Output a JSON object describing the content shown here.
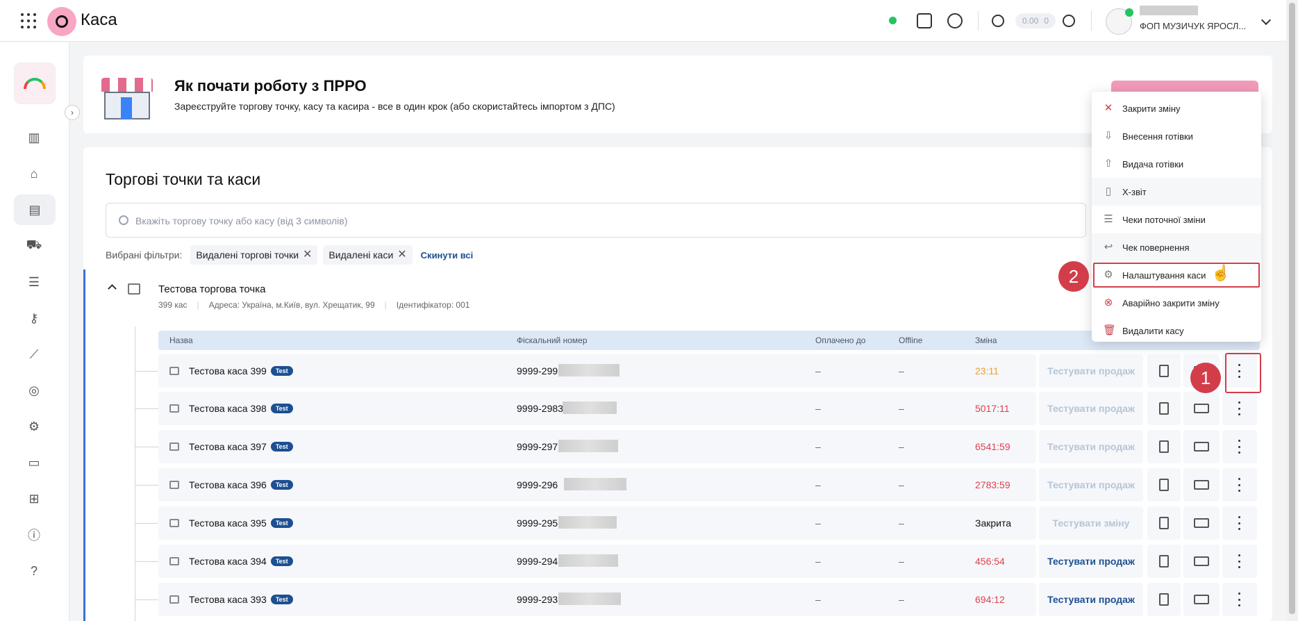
{
  "header": {
    "brand": "Каса",
    "balance_amount": "0.00",
    "balance_count": "0",
    "account_name": "ФОП МУЗИЧУК ЯРОСЛ..."
  },
  "banner": {
    "title": "Як почати роботу з ПРРО",
    "subtitle": "Зареєструйте торгову точку, касу та касира - все в один крок (або скористайтесь імпортом з ДПС)"
  },
  "section": {
    "title": "Торгові точки та каси",
    "search_placeholder": "Вкажіть торгову точку або касу (від 3 символів)",
    "filters_label": "Вибрані фільтри:",
    "filters": [
      "Видалені торгові точки",
      "Видалені каси"
    ],
    "reset_label": "Скинути всі"
  },
  "point": {
    "name": "Тестова торгова точка",
    "count": "399 кас",
    "address": "Адреса: Україна, м.Київ, вул. Хрещатик, 99",
    "identifier": "Ідентифікатор: 001"
  },
  "table": {
    "headers": [
      "Назва",
      "Фіскальний номер",
      "Оплачено до",
      "Offline",
      "Зміна"
    ],
    "badge": "Test",
    "rows": [
      {
        "name": "Тестова каса 399",
        "fiscal": "9999-299",
        "paid": "–",
        "offline": "–",
        "shift": "23:11",
        "shift_color": "#f0a030",
        "action": "Тестувати продаж",
        "action_enabled": false
      },
      {
        "name": "Тестова каса 398",
        "fiscal": "9999-2983",
        "paid": "–",
        "offline": "–",
        "shift": "5017:11",
        "shift_color": "#e04050",
        "action": "Тестувати продаж",
        "action_enabled": false
      },
      {
        "name": "Тестова каса 397",
        "fiscal": "9999-297",
        "paid": "–",
        "offline": "–",
        "shift": "6541:59",
        "shift_color": "#e04050",
        "action": "Тестувати продаж",
        "action_enabled": false
      },
      {
        "name": "Тестова каса 396",
        "fiscal": "9999-296",
        "paid": "–",
        "offline": "–",
        "shift": "2783:59",
        "shift_color": "#e04050",
        "action": "Тестувати продаж",
        "action_enabled": false
      },
      {
        "name": "Тестова каса 395",
        "fiscal": "9999-295",
        "paid": "–",
        "offline": "–",
        "shift": "Закрита",
        "shift_color": "#111111",
        "action": "Тестувати зміну",
        "action_enabled": false
      },
      {
        "name": "Тестова каса 394",
        "fiscal": "9999-294",
        "paid": "–",
        "offline": "–",
        "shift": "456:54",
        "shift_color": "#e04050",
        "action": "Тестувати продаж",
        "action_enabled": true
      },
      {
        "name": "Тестова каса 393",
        "fiscal": "9999-293",
        "paid": "–",
        "offline": "–",
        "shift": "694:12",
        "shift_color": "#e04050",
        "action": "Тестувати продаж",
        "action_enabled": true
      }
    ]
  },
  "menu": {
    "items": [
      {
        "label": "Закрити зміну",
        "icon": "close-icon"
      },
      {
        "label": "Внесення готівки",
        "icon": "arrow-down-icon"
      },
      {
        "label": "Видача готівки",
        "icon": "arrow-up-icon"
      },
      {
        "label": "X-звіт",
        "icon": "report-icon"
      },
      {
        "label": "Чеки поточної зміни",
        "icon": "receipts-icon"
      },
      {
        "label": "Чек повернення",
        "icon": "return-icon"
      },
      {
        "label": "Налаштування каси",
        "icon": "gear-icon"
      },
      {
        "label": "Аварійно закрити зміну",
        "icon": "emergency-close-icon"
      },
      {
        "label": "Видалити касу",
        "icon": "trash-icon"
      }
    ]
  },
  "callouts": [
    "1",
    "2"
  ],
  "colors": {
    "accent": "#1d4f91",
    "callout": "#d33d4a",
    "brand_pink": "#f7a6c4"
  }
}
